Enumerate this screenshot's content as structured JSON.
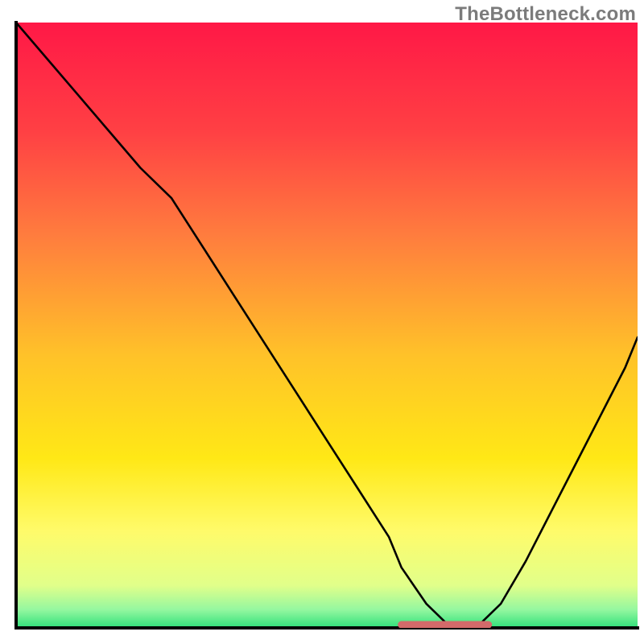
{
  "watermark": "TheBottleneck.com",
  "chart_data": {
    "type": "line",
    "title": "",
    "xlabel": "",
    "ylabel": "",
    "xlim": [
      0,
      100
    ],
    "ylim": [
      0,
      100
    ],
    "grid": false,
    "legend": false,
    "background": {
      "style": "vertical-gradient",
      "stops": [
        {
          "pos": 0.0,
          "color": "#ff1846"
        },
        {
          "pos": 0.18,
          "color": "#ff4044"
        },
        {
          "pos": 0.35,
          "color": "#ff7c3e"
        },
        {
          "pos": 0.55,
          "color": "#ffc229"
        },
        {
          "pos": 0.72,
          "color": "#ffe816"
        },
        {
          "pos": 0.84,
          "color": "#fffb6a"
        },
        {
          "pos": 0.93,
          "color": "#e1ff8a"
        },
        {
          "pos": 0.97,
          "color": "#94f7a0"
        },
        {
          "pos": 1.0,
          "color": "#2fe07a"
        }
      ]
    },
    "series": [
      {
        "name": "bottleneck-curve",
        "x": [
          0,
          5,
          10,
          15,
          20,
          25,
          30,
          35,
          40,
          45,
          50,
          55,
          60,
          62,
          66,
          70,
          74,
          78,
          82,
          86,
          90,
          94,
          98,
          100
        ],
        "y": [
          100,
          94,
          88,
          82,
          76,
          71,
          63,
          55,
          47,
          39,
          31,
          23,
          15,
          10,
          4,
          0,
          0,
          4,
          11,
          19,
          27,
          35,
          43,
          48
        ]
      }
    ],
    "marker": {
      "name": "optimal-range",
      "y": 0,
      "x_start": 62,
      "x_end": 76,
      "color": "#d36a6a"
    },
    "axes": {
      "color": "#000000",
      "width": 4
    }
  }
}
